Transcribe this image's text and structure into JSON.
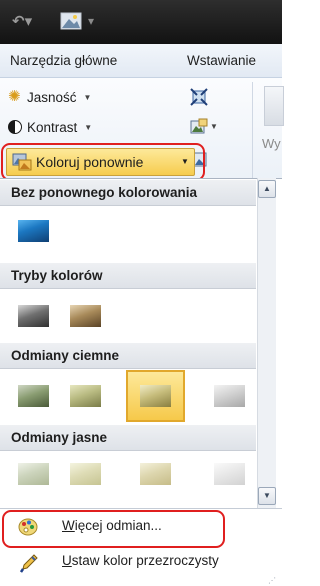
{
  "quick_access": {
    "undo_icon": "undo-icon",
    "picture_icon": "picture-icon",
    "customize_icon": "customize-quick-access-icon"
  },
  "ribbon_tabs": [
    {
      "label": "Narzędzia główne"
    },
    {
      "label": "Wstawianie"
    }
  ],
  "adjust_group": {
    "brightness": {
      "label": "Jasność",
      "icon": "brightness-sun-icon"
    },
    "contrast": {
      "label": "Kontrast",
      "icon": "contrast-circle-icon"
    },
    "recolor": {
      "label": "Koloruj ponownie",
      "icon": "recolor-icon"
    }
  },
  "ribbon_partial_label": "Wy",
  "recolor_menu": {
    "sections": [
      {
        "title": "Bez ponownego kolorowania"
      },
      {
        "title": "Tryby kolorów"
      },
      {
        "title": "Odmiany ciemne"
      },
      {
        "title": "Odmiany jasne"
      }
    ],
    "commands": {
      "more_variations": {
        "label": "Więcej odmian...",
        "accesskey": "W",
        "icon": "palette-icon"
      },
      "set_transparent": {
        "label": "Ustaw kolor przezroczysty",
        "accesskey": "U",
        "icon": "eyedropper-pen-icon"
      }
    }
  },
  "colors": {
    "highlight_border": "#e01f1f",
    "selected_fill": "#f6cc4e",
    "title_bar": "#1a1a1a",
    "section_header": "#e4e7ec"
  }
}
